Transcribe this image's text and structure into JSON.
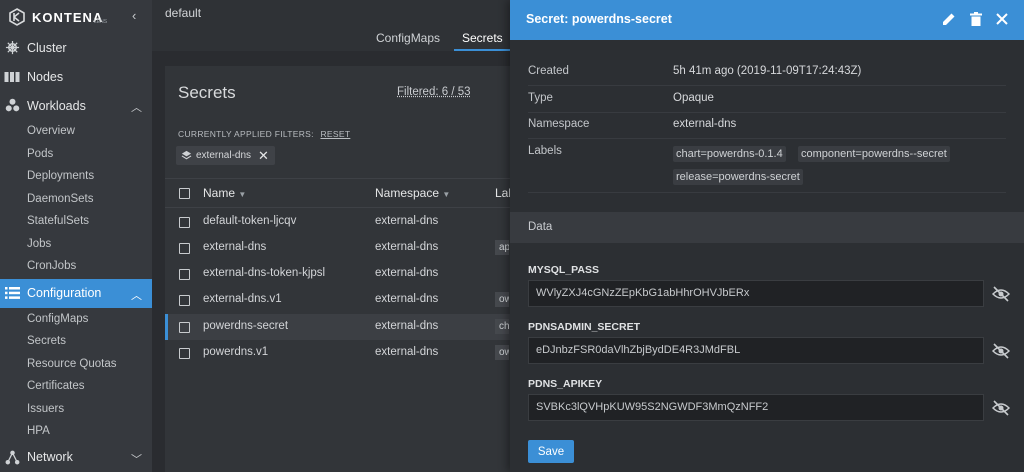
{
  "brand": {
    "name": "KONTENA",
    "sub": "LENS"
  },
  "sidebar": {
    "items": [
      {
        "label": "Cluster",
        "icon": "helm-icon"
      },
      {
        "label": "Nodes",
        "icon": "nodes-icon"
      },
      {
        "label": "Workloads",
        "icon": "workloads-icon",
        "expanded": true,
        "children": [
          "Overview",
          "Pods",
          "Deployments",
          "DaemonSets",
          "StatefulSets",
          "Jobs",
          "CronJobs"
        ]
      },
      {
        "label": "Configuration",
        "icon": "list-icon",
        "expanded": true,
        "active": true,
        "children": [
          "ConfigMaps",
          "Secrets",
          "Resource Quotas",
          "Certificates",
          "Issuers",
          "HPA"
        ]
      },
      {
        "label": "Network",
        "icon": "network-icon"
      }
    ]
  },
  "topbar": {
    "namespace": "default"
  },
  "tabs": [
    {
      "label": "ConfigMaps"
    },
    {
      "label": "Secrets",
      "active": true
    }
  ],
  "panel": {
    "title": "Secrets",
    "filtered": "Filtered: 6 / 53",
    "filters_label": "CURRENTLY APPLIED FILTERS:",
    "reset": "RESET",
    "chip": "external-dns",
    "columns": {
      "name": "Name",
      "namespace": "Namespace",
      "labels": "Lab"
    },
    "rows": [
      {
        "name": "default-token-ljcqv",
        "namespace": "external-dns",
        "label": ""
      },
      {
        "name": "external-dns",
        "namespace": "external-dns",
        "label": "ap"
      },
      {
        "name": "external-dns-token-kjpsl",
        "namespace": "external-dns",
        "label": ""
      },
      {
        "name": "external-dns.v1",
        "namespace": "external-dns",
        "label": "ow"
      },
      {
        "name": "powerdns-secret",
        "namespace": "external-dns",
        "label": "ch",
        "selected": true
      },
      {
        "name": "powerdns.v1",
        "namespace": "external-dns",
        "label": "ow"
      }
    ]
  },
  "drawer": {
    "title": "Secret: powerdns-secret",
    "meta": {
      "created_key": "Created",
      "created_val": "5h 41m ago (2019-11-09T17:24:43Z)",
      "type_key": "Type",
      "type_val": "Opaque",
      "ns_key": "Namespace",
      "ns_val": "external-dns",
      "labels_key": "Labels"
    },
    "labels": [
      "chart=powerdns-0.1.4",
      "component=powerdns--secret",
      "release=powerdns-secret"
    ],
    "data_title": "Data",
    "fields": [
      {
        "key": "MYSQL_PASS",
        "value": "WVlyZXJ4cGNzZEpKbG1abHhrOHVJbERx"
      },
      {
        "key": "PDNSADMIN_SECRET",
        "value": "eDJnbzFSR0daVlhZbjBydDE4R3JMdFBL"
      },
      {
        "key": "PDNS_APIKEY",
        "value": "SVBKc3lQVHpKUW95S2NGWDF3MmQzNFF2"
      }
    ],
    "save": "Save"
  },
  "colors": {
    "accent": "#3b8fd6",
    "sidebar": "#36393e",
    "background": "#2a2c30"
  }
}
